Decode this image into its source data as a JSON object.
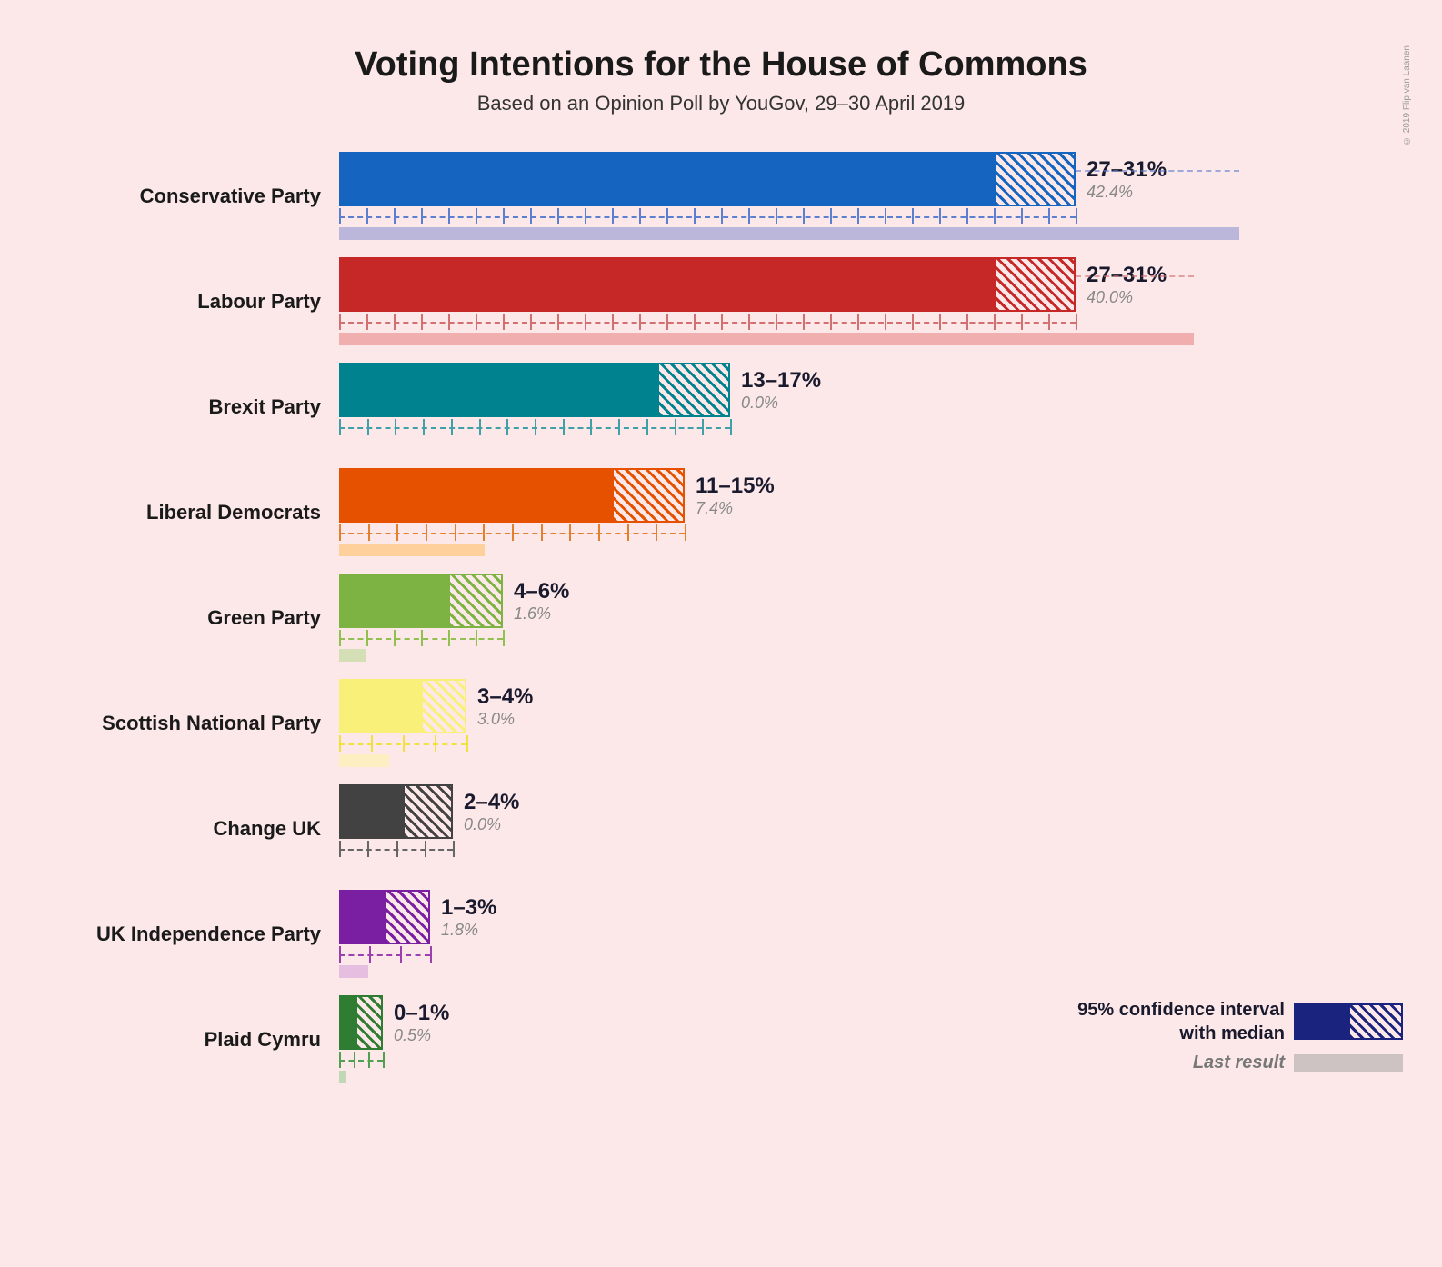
{
  "title": "Voting Intentions for the House of Commons",
  "subtitle": "Based on an Opinion Poll by YouGov, 29–30 April 2019",
  "copyright": "© 2019 Flip van Laanen",
  "parties": [
    {
      "name": "Conservative Party",
      "range": "27–31%",
      "last": "42.4%",
      "color": "#1565c0",
      "solidWidth": 720,
      "hatchWidth": 90,
      "lastWidth": 990,
      "lastColor": "#7986cb",
      "confColor": "#5c7fd0"
    },
    {
      "name": "Labour Party",
      "range": "27–31%",
      "last": "40.0%",
      "color": "#c62828",
      "solidWidth": 720,
      "hatchWidth": 90,
      "lastWidth": 940,
      "lastColor": "#e57373",
      "confColor": "#d07070"
    },
    {
      "name": "Brexit Party",
      "range": "13–17%",
      "last": "0.0%",
      "color": "#00838f",
      "solidWidth": 350,
      "hatchWidth": 80,
      "lastWidth": 0,
      "lastColor": "#80cbc4",
      "confColor": "#40a0a8"
    },
    {
      "name": "Liberal Democrats",
      "range": "11–15%",
      "last": "7.4%",
      "color": "#e65100",
      "solidWidth": 300,
      "hatchWidth": 80,
      "lastWidth": 160,
      "lastColor": "#ffb74d",
      "confColor": "#e08030"
    },
    {
      "name": "Green Party",
      "range": "4–6%",
      "last": "1.6%",
      "color": "#7cb342",
      "solidWidth": 120,
      "hatchWidth": 60,
      "lastWidth": 30,
      "lastColor": "#aed581",
      "confColor": "#90c050"
    },
    {
      "name": "Scottish National Party",
      "range": "3–4%",
      "last": "3.0%",
      "color": "#f9f07a",
      "solidWidth": 90,
      "hatchWidth": 50,
      "lastWidth": 55,
      "lastColor": "#fff59d",
      "confColor": "#f0e040"
    },
    {
      "name": "Change UK",
      "range": "2–4%",
      "last": "0.0%",
      "color": "#424242",
      "solidWidth": 70,
      "hatchWidth": 55,
      "lastWidth": 0,
      "lastColor": "#9e9e9e",
      "confColor": "#666"
    },
    {
      "name": "UK Independence Party",
      "range": "1–3%",
      "last": "1.8%",
      "color": "#7b1fa2",
      "solidWidth": 50,
      "hatchWidth": 50,
      "lastWidth": 32,
      "lastColor": "#ce93d8",
      "confColor": "#9c40b0"
    },
    {
      "name": "Plaid Cymru",
      "range": "0–1%",
      "last": "0.5%",
      "color": "#2e7d32",
      "solidWidth": 18,
      "hatchWidth": 30,
      "lastWidth": 8,
      "lastColor": "#81c784",
      "confColor": "#50a050"
    }
  ],
  "legend": {
    "confidenceLabel": "95% confidence interval\nwith median",
    "lastLabel": "Last result"
  }
}
